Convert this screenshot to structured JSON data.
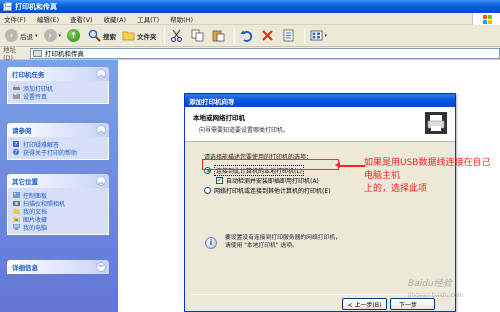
{
  "window": {
    "title": "打印机和传真"
  },
  "menu": [
    "文件(F)",
    "编辑(E)",
    "查看(V)",
    "收藏(A)",
    "工具(T)",
    "帮助(H)"
  ],
  "toolbar": {
    "back": "后退",
    "search": "搜索",
    "folders": "文件夹"
  },
  "address": {
    "label": "地址(D)",
    "value": "打印机和传真"
  },
  "left_panels": [
    {
      "title": "打印机任务",
      "items": [
        "添加打印机",
        "设置传真"
      ]
    },
    {
      "title": "请参阅",
      "items": [
        "打印疑难解答",
        "获得关于打印的帮助"
      ]
    },
    {
      "title": "其它位置",
      "items": [
        "控制面板",
        "扫描仪和照相机",
        "我的文档",
        "图片收藏",
        "我的电脑"
      ]
    },
    {
      "title": "详细信息",
      "items": []
    }
  ],
  "dialog": {
    "title": "添加打印机向导",
    "header_title": "本地或网络打印机",
    "header_sub": "向导需要知道要设置哪类打印机。",
    "question": "请选择能描述您要使用的打印机的选项：",
    "option_local": "连接到此计算机的本地打印机(L)",
    "option_autodetect": "自动检测并安装即插即用打印机(A)",
    "option_network": "网络打印机或连接到其他计算机的打印机(E)",
    "info_line1": "要设置没有连接到打印服务器的网络打印机，",
    "info_line2": "请使用 \"本地打印机\" 选项。",
    "btn_back": "< 上一步(B)",
    "btn_next": "下一步"
  },
  "annotation": {
    "line1": "如果是用USB数据线连接在自己电脑主机",
    "line2": "上的，选择此项"
  },
  "watermark": {
    "brand": "Baidu经验",
    "url": "jingyan.baidu.com"
  }
}
